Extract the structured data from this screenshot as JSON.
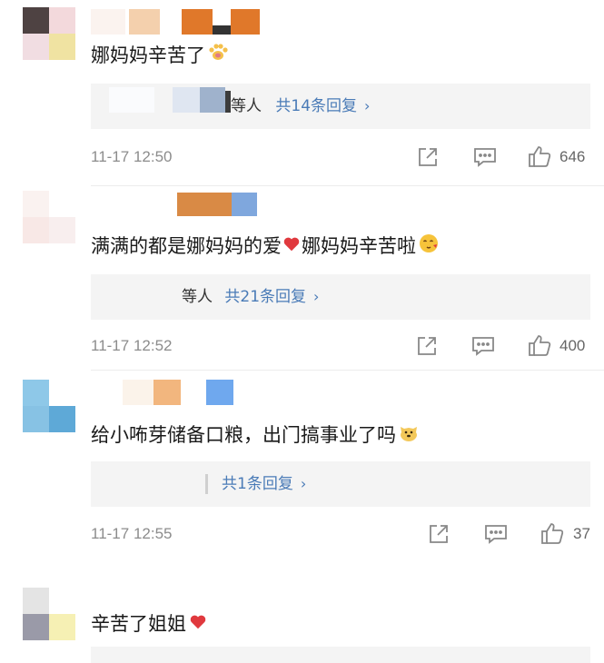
{
  "colors": {
    "reply_link": "#4a7bb7",
    "muted_text": "#8c8c8c",
    "reply_bg": "#f4f4f4",
    "icon": "#888888",
    "heart": "#e0393e"
  },
  "comments": [
    {
      "text": "娜妈妈辛苦了",
      "emoji": "paw-emoji",
      "reply_tail": "等人",
      "reply_link": "共14条回复",
      "time": "11-17 12:50",
      "likes": "646"
    },
    {
      "text_before": "满满的都是娜妈妈的爱",
      "heart": "heart-emoji",
      "text_after": "娜妈妈辛苦啦",
      "emoji": "kiss-face-emoji",
      "reply_tail": "等人",
      "reply_link": "共21条回复",
      "time": "11-17 12:52",
      "likes": "400"
    },
    {
      "text": "给小咘芽储备口粮，出门搞事业了吗",
      "emoji": "doge-emoji",
      "reply_link": "共1条回复",
      "time": "11-17 12:55",
      "likes": "37"
    },
    {
      "text": "辛苦了姐姐",
      "emoji": "heart-emoji"
    }
  ],
  "icons": {
    "share": "share-icon",
    "comment": "comment-icon",
    "like": "thumbs-up-icon",
    "chevron": "chevron-right-icon"
  }
}
